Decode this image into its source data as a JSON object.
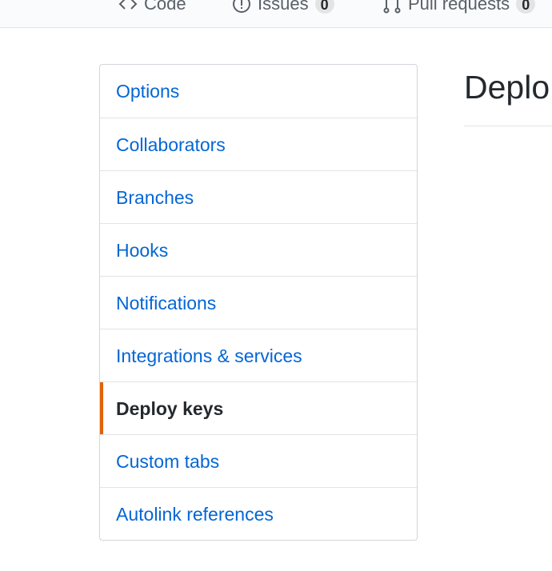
{
  "repo_nav": {
    "tabs": [
      {
        "label": "Code",
        "icon": "code-icon"
      },
      {
        "label": "Issues",
        "icon": "issue-opened-icon",
        "count": "0"
      },
      {
        "label": "Pull requests",
        "icon": "git-pull-request-icon",
        "count": "0"
      }
    ]
  },
  "settings_menu": {
    "items": [
      {
        "label": "Options"
      },
      {
        "label": "Collaborators"
      },
      {
        "label": "Branches"
      },
      {
        "label": "Hooks"
      },
      {
        "label": "Notifications"
      },
      {
        "label": "Integrations & services"
      },
      {
        "label": "Deploy keys",
        "selected": true
      },
      {
        "label": "Custom tabs"
      },
      {
        "label": "Autolink references"
      }
    ]
  },
  "main": {
    "title": "Deplo"
  },
  "colors": {
    "link": "#0366d6",
    "selected_marker": "#e36209",
    "text": "#24292e",
    "border": "#d1d5da"
  }
}
